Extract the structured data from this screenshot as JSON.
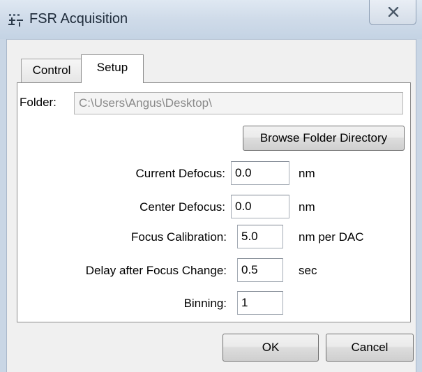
{
  "window": {
    "title": "FSR Acquisition",
    "close_glyph": "X"
  },
  "tabs": [
    {
      "label": "Control",
      "selected": false
    },
    {
      "label": "Setup",
      "selected": true
    }
  ],
  "setup": {
    "folder_label": "Folder:",
    "folder_value": "C:\\Users\\Angus\\Desktop\\",
    "browse_label": "Browse Folder Directory",
    "fields": [
      {
        "label": "Current Defocus:",
        "value": "0.0",
        "unit": "nm"
      },
      {
        "label": "Center Defocus:",
        "value": "0.0",
        "unit": "nm"
      },
      {
        "label": "Focus Calibration:",
        "value": "5.0",
        "unit": "nm per DAC"
      },
      {
        "label": "Delay after Focus Change:",
        "value": "0.5",
        "unit": "sec"
      },
      {
        "label": "Binning:",
        "value": "1",
        "unit": ""
      }
    ]
  },
  "buttons": {
    "ok": "OK",
    "cancel": "Cancel"
  },
  "icons": {
    "app": "app-icon",
    "close": "close-icon"
  }
}
